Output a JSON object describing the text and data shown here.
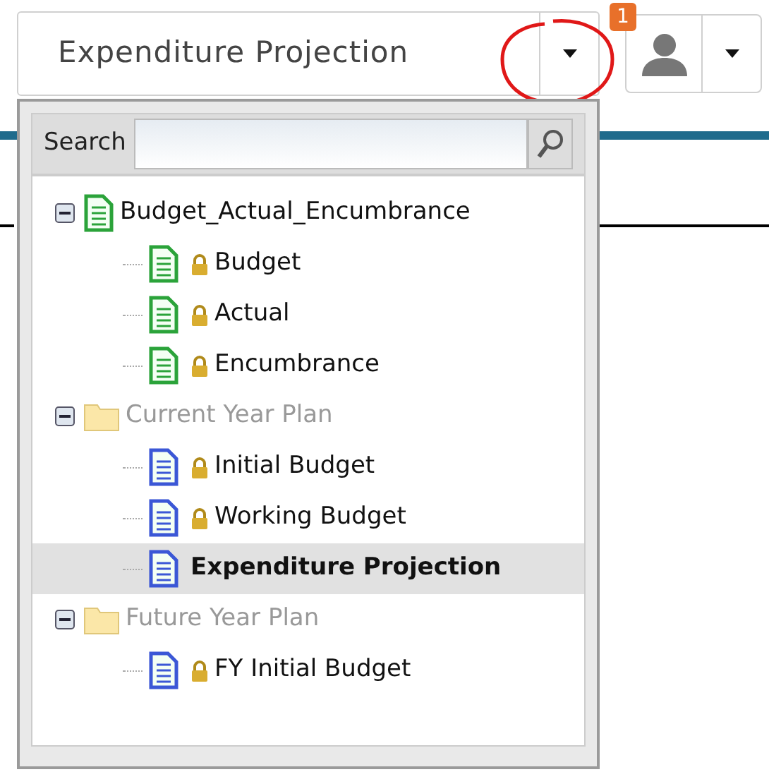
{
  "selector": {
    "value": "Expenditure Projection"
  },
  "notification_badge": "1",
  "search": {
    "label": "Search"
  },
  "tree": [
    {
      "label": "Budget_Actual_Encumbrance",
      "kind": "report-group",
      "expanded": true,
      "children": [
        {
          "label": "Budget",
          "kind": "green-doc",
          "locked": true,
          "selected": false
        },
        {
          "label": "Actual",
          "kind": "green-doc",
          "locked": true,
          "selected": false
        },
        {
          "label": "Encumbrance",
          "kind": "green-doc",
          "locked": true,
          "selected": false
        }
      ]
    },
    {
      "label": "Current Year Plan",
      "kind": "folder",
      "expanded": true,
      "children": [
        {
          "label": "Initial Budget",
          "kind": "blue-doc",
          "locked": true,
          "selected": false
        },
        {
          "label": "Working Budget",
          "kind": "blue-doc",
          "locked": true,
          "selected": false
        },
        {
          "label": "Expenditure Projection",
          "kind": "blue-doc",
          "locked": false,
          "selected": true
        }
      ]
    },
    {
      "label": "Future Year Plan",
      "kind": "folder",
      "expanded": true,
      "children": [
        {
          "label": "FY Initial Budget",
          "kind": "blue-doc",
          "locked": true,
          "selected": false
        }
      ]
    }
  ]
}
